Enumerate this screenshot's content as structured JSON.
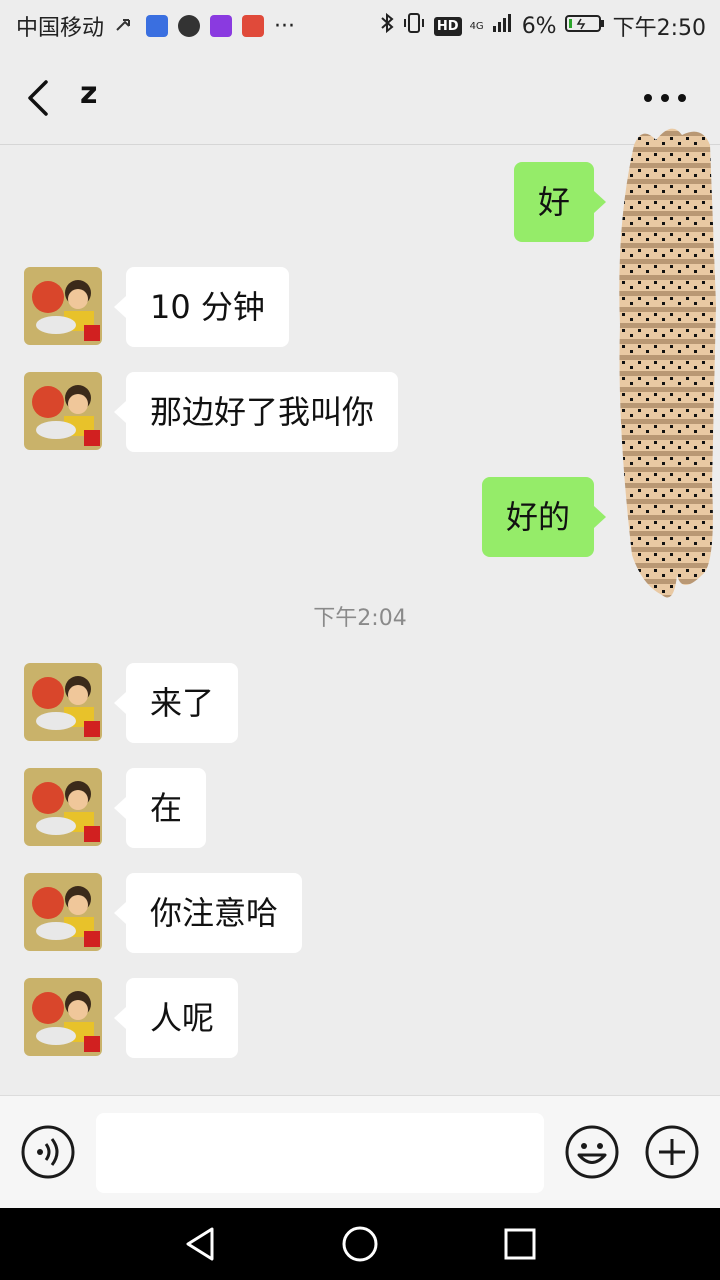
{
  "status_bar": {
    "carrier": "中国移动",
    "battery": "6%",
    "time": "下午2:50",
    "network": "4G"
  },
  "header": {
    "title": "z"
  },
  "messages": [
    {
      "from": "me",
      "text": "好"
    },
    {
      "from": "other",
      "text": "10 分钟"
    },
    {
      "from": "other",
      "text": "那边好了我叫你"
    },
    {
      "from": "me",
      "text": "好的"
    },
    {
      "from": "other",
      "text": "来了"
    },
    {
      "from": "other",
      "text": "在"
    },
    {
      "from": "other",
      "text": "你注意哈"
    },
    {
      "from": "other",
      "text": "人呢"
    }
  ],
  "timestamp": "下午2:04",
  "colors": {
    "bg": "#ededed",
    "out_bubble": "#95ec69",
    "in_bubble": "#ffffff",
    "nav_bar": "#000000"
  },
  "icons": [
    "back-arrow-icon",
    "more-icon",
    "voice-icon",
    "emoji-icon",
    "plus-icon",
    "nav-back-icon",
    "nav-home-icon",
    "nav-recents-icon"
  ]
}
